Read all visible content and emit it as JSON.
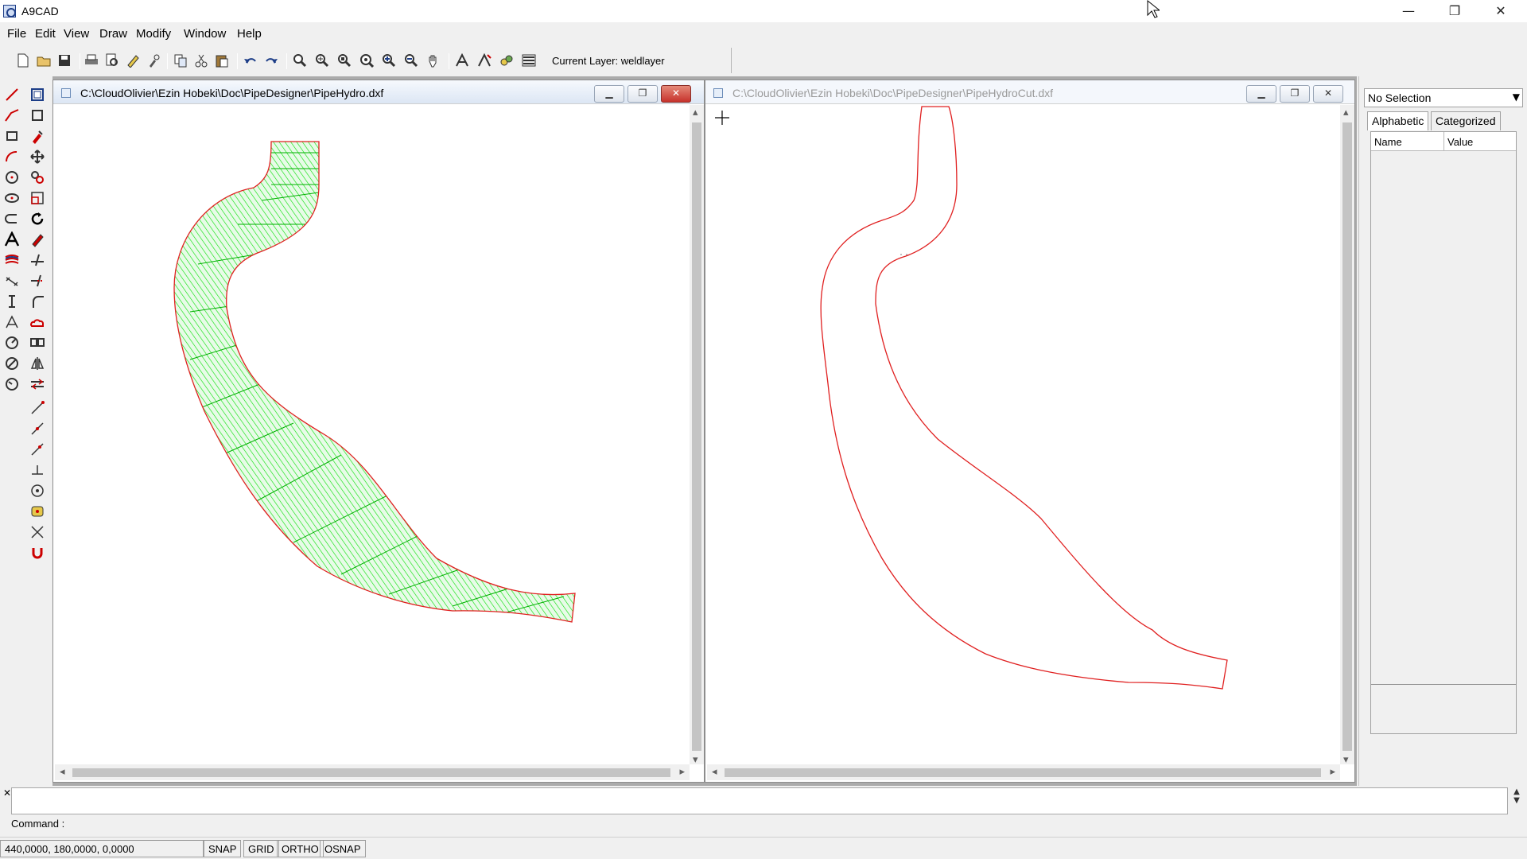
{
  "app": {
    "title": "A9CAD"
  },
  "window_controls": {
    "minimize": "—",
    "restore": "❐",
    "close": "✕"
  },
  "menu": [
    "File",
    "Edit",
    "View",
    "Draw",
    "Modify",
    "Window",
    "Help"
  ],
  "toolbar": {
    "current_layer_label": "Current Layer: weldlayer",
    "icons": [
      "new-file-icon",
      "open-folder-icon",
      "save-icon",
      "print-icon",
      "print-preview-icon",
      "pen-icon",
      "properties-icon",
      "copy-icon",
      "cut-icon",
      "paste-icon",
      "undo-icon",
      "redo-icon",
      "zoom-window-icon",
      "zoom-all-icon",
      "zoom-extents-icon",
      "zoom-previous-icon",
      "zoom-in-icon",
      "zoom-out-icon",
      "pan-icon",
      "text-style-icon",
      "dim-style-icon",
      "layer-properties-icon",
      "layers-icon"
    ]
  },
  "left_tools": {
    "col1": [
      "line-icon",
      "polyline-icon",
      "rectangle-icon",
      "arc-icon",
      "circle-icon",
      "ellipse-icon",
      "polyline-arc-icon",
      "text-icon",
      "hatch-icon",
      "dimension-aligned-icon",
      "dimension-linear-icon",
      "dimension-angular-icon",
      "dimension-radius-icon",
      "dimension-diameter-icon",
      "dimension-center-icon"
    ],
    "col2": [
      "select-icon",
      "stretch-box-icon",
      "paint-icon",
      "move-icon",
      "copy-objects-icon",
      "scale-icon",
      "rotate-icon",
      "erase-icon",
      "trim-icon",
      "extend-icon",
      "fillet-icon",
      "cloud-icon",
      "array-icon",
      "mirror-icon",
      "offset-icon",
      "snap-endpoint-icon",
      "snap-midpoint-icon",
      "snap-nearest-icon",
      "snap-perpendicular-icon",
      "snap-center-icon",
      "snap-node-icon",
      "snap-intersection-icon",
      "snap-magnet-icon"
    ]
  },
  "documents": [
    {
      "title": "C:\\CloudOlivier\\Ezin Hobeki\\Doc\\PipeDesigner\\PipeHydro.dxf",
      "active": true
    },
    {
      "title": "C:\\CloudOlivier\\Ezin Hobeki\\Doc\\PipeDesigner\\PipeHydroCut.dxf",
      "active": false
    }
  ],
  "child_buttons": {
    "minimize": "▁",
    "restore": "❐",
    "close": "✕"
  },
  "properties": {
    "selection": "No Selection",
    "tabs": [
      "Alphabetic",
      "Categorized"
    ],
    "columns": [
      "Name",
      "Value"
    ]
  },
  "command": {
    "label": "Command :",
    "value": ""
  },
  "status": {
    "coords": "440,0000, 180,0000, 0,0000",
    "toggles": [
      "SNAP",
      "GRID",
      "ORTHO",
      "OSNAP"
    ]
  },
  "colors": {
    "pipe_fill": "#00e000",
    "outline": "#e02020",
    "mdi_background": "#ababab"
  }
}
